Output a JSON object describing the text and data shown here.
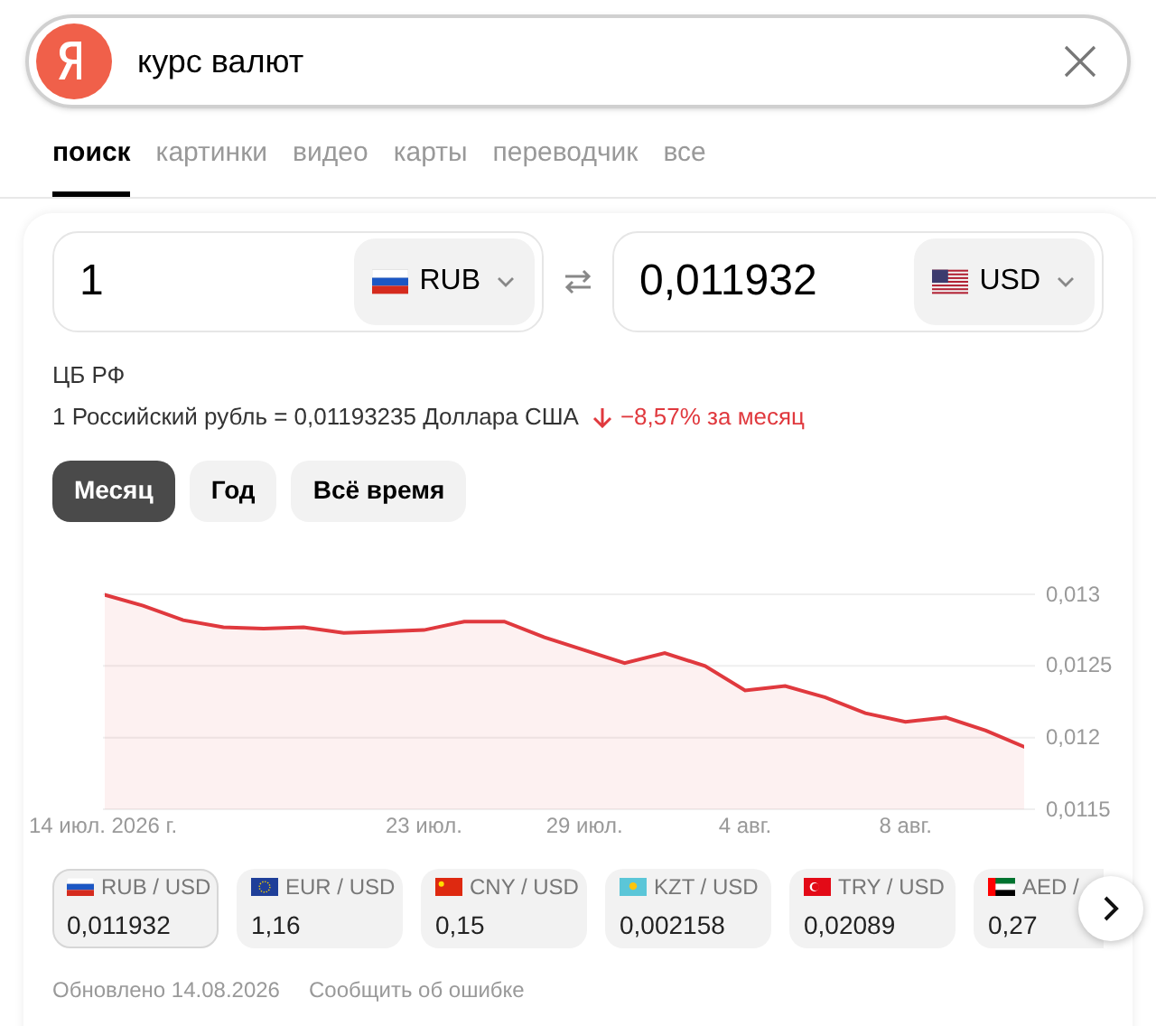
{
  "search": {
    "value": "курс валют"
  },
  "tabs": [
    {
      "label": "поиск",
      "selected": true
    },
    {
      "label": "картинки",
      "selected": false
    },
    {
      "label": "видео",
      "selected": false
    },
    {
      "label": "карты",
      "selected": false
    },
    {
      "label": "переводчик",
      "selected": false
    },
    {
      "label": "все",
      "selected": false
    }
  ],
  "converter": {
    "from": {
      "amount": "1",
      "currency": "RUB",
      "kind": "ru"
    },
    "to": {
      "amount": "0,011932",
      "currency": "USD",
      "kind": "us"
    }
  },
  "source": "ЦБ РФ",
  "rate_text": "1 Российский рубль = 0,01193235 Доллара США",
  "change": {
    "kind": "down",
    "value": "−8,57%",
    "period": "за месяц"
  },
  "periods": [
    {
      "label": "Месяц",
      "selected": true
    },
    {
      "label": "Год",
      "selected": false
    },
    {
      "label": "Всё время",
      "selected": false
    }
  ],
  "chart_data": {
    "type": "area",
    "categories": [
      "14 июл. 2026 г.",
      null,
      null,
      null,
      null,
      null,
      null,
      null,
      "23 июл.",
      null,
      null,
      null,
      "29 июл.",
      null,
      null,
      null,
      "4 авг.",
      null,
      null,
      null,
      "8 авг.",
      null,
      null,
      null
    ],
    "series": [
      {
        "color": "#e0393e",
        "values": [
          0.013,
          0.01292,
          0.01282,
          0.01277,
          0.01276,
          0.01277,
          0.01273,
          0.01274,
          0.01275,
          0.01281,
          0.01281,
          0.0127,
          0.01261,
          0.01252,
          0.01259,
          0.0125,
          0.01233,
          0.01236,
          0.01228,
          0.01217,
          0.01211,
          0.01214,
          0.01205,
          0.01193
        ]
      }
    ],
    "grid": true,
    "ylim": [
      0.0115,
      0.013
    ],
    "yticks": [
      {
        "value": 0.013,
        "label": "0,013"
      },
      {
        "value": 0.0125,
        "label": "0,0125"
      },
      {
        "value": 0.012,
        "label": "0,012"
      },
      {
        "value": 0.0115,
        "label": "0,0115"
      }
    ]
  },
  "pairs": [
    {
      "label": "RUB / USD",
      "value": "0,011932",
      "kind": "ru",
      "selected": true
    },
    {
      "label": "EUR / USD",
      "value": "1,16",
      "kind": "eu",
      "selected": false
    },
    {
      "label": "CNY / USD",
      "value": "0,15",
      "kind": "cn",
      "selected": false
    },
    {
      "label": "KZT / USD",
      "value": "0,002158",
      "kind": "kz",
      "selected": false
    },
    {
      "label": "TRY / USD",
      "value": "0,02089",
      "kind": "tr",
      "selected": false
    },
    {
      "label": "AED /",
      "value": "0,27",
      "kind": "ae",
      "selected": false
    }
  ],
  "footer": {
    "updated": "Обновлено 14.08.2026",
    "report": "Сообщить об ошибке"
  }
}
